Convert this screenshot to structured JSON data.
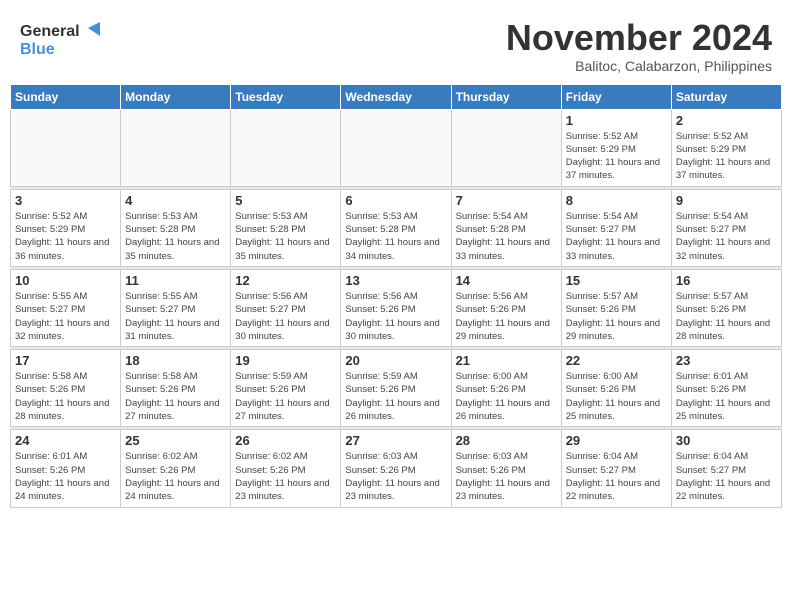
{
  "header": {
    "logo_general": "General",
    "logo_blue": "Blue",
    "month_title": "November 2024",
    "location": "Balitoc, Calabarzon, Philippines"
  },
  "days_of_week": [
    "Sunday",
    "Monday",
    "Tuesday",
    "Wednesday",
    "Thursday",
    "Friday",
    "Saturday"
  ],
  "weeks": [
    [
      {
        "day": "",
        "info": ""
      },
      {
        "day": "",
        "info": ""
      },
      {
        "day": "",
        "info": ""
      },
      {
        "day": "",
        "info": ""
      },
      {
        "day": "",
        "info": ""
      },
      {
        "day": "1",
        "info": "Sunrise: 5:52 AM\nSunset: 5:29 PM\nDaylight: 11 hours and 37 minutes."
      },
      {
        "day": "2",
        "info": "Sunrise: 5:52 AM\nSunset: 5:29 PM\nDaylight: 11 hours and 37 minutes."
      }
    ],
    [
      {
        "day": "3",
        "info": "Sunrise: 5:52 AM\nSunset: 5:29 PM\nDaylight: 11 hours and 36 minutes."
      },
      {
        "day": "4",
        "info": "Sunrise: 5:53 AM\nSunset: 5:28 PM\nDaylight: 11 hours and 35 minutes."
      },
      {
        "day": "5",
        "info": "Sunrise: 5:53 AM\nSunset: 5:28 PM\nDaylight: 11 hours and 35 minutes."
      },
      {
        "day": "6",
        "info": "Sunrise: 5:53 AM\nSunset: 5:28 PM\nDaylight: 11 hours and 34 minutes."
      },
      {
        "day": "7",
        "info": "Sunrise: 5:54 AM\nSunset: 5:28 PM\nDaylight: 11 hours and 33 minutes."
      },
      {
        "day": "8",
        "info": "Sunrise: 5:54 AM\nSunset: 5:27 PM\nDaylight: 11 hours and 33 minutes."
      },
      {
        "day": "9",
        "info": "Sunrise: 5:54 AM\nSunset: 5:27 PM\nDaylight: 11 hours and 32 minutes."
      }
    ],
    [
      {
        "day": "10",
        "info": "Sunrise: 5:55 AM\nSunset: 5:27 PM\nDaylight: 11 hours and 32 minutes."
      },
      {
        "day": "11",
        "info": "Sunrise: 5:55 AM\nSunset: 5:27 PM\nDaylight: 11 hours and 31 minutes."
      },
      {
        "day": "12",
        "info": "Sunrise: 5:56 AM\nSunset: 5:27 PM\nDaylight: 11 hours and 30 minutes."
      },
      {
        "day": "13",
        "info": "Sunrise: 5:56 AM\nSunset: 5:26 PM\nDaylight: 11 hours and 30 minutes."
      },
      {
        "day": "14",
        "info": "Sunrise: 5:56 AM\nSunset: 5:26 PM\nDaylight: 11 hours and 29 minutes."
      },
      {
        "day": "15",
        "info": "Sunrise: 5:57 AM\nSunset: 5:26 PM\nDaylight: 11 hours and 29 minutes."
      },
      {
        "day": "16",
        "info": "Sunrise: 5:57 AM\nSunset: 5:26 PM\nDaylight: 11 hours and 28 minutes."
      }
    ],
    [
      {
        "day": "17",
        "info": "Sunrise: 5:58 AM\nSunset: 5:26 PM\nDaylight: 11 hours and 28 minutes."
      },
      {
        "day": "18",
        "info": "Sunrise: 5:58 AM\nSunset: 5:26 PM\nDaylight: 11 hours and 27 minutes."
      },
      {
        "day": "19",
        "info": "Sunrise: 5:59 AM\nSunset: 5:26 PM\nDaylight: 11 hours and 27 minutes."
      },
      {
        "day": "20",
        "info": "Sunrise: 5:59 AM\nSunset: 5:26 PM\nDaylight: 11 hours and 26 minutes."
      },
      {
        "day": "21",
        "info": "Sunrise: 6:00 AM\nSunset: 5:26 PM\nDaylight: 11 hours and 26 minutes."
      },
      {
        "day": "22",
        "info": "Sunrise: 6:00 AM\nSunset: 5:26 PM\nDaylight: 11 hours and 25 minutes."
      },
      {
        "day": "23",
        "info": "Sunrise: 6:01 AM\nSunset: 5:26 PM\nDaylight: 11 hours and 25 minutes."
      }
    ],
    [
      {
        "day": "24",
        "info": "Sunrise: 6:01 AM\nSunset: 5:26 PM\nDaylight: 11 hours and 24 minutes."
      },
      {
        "day": "25",
        "info": "Sunrise: 6:02 AM\nSunset: 5:26 PM\nDaylight: 11 hours and 24 minutes."
      },
      {
        "day": "26",
        "info": "Sunrise: 6:02 AM\nSunset: 5:26 PM\nDaylight: 11 hours and 23 minutes."
      },
      {
        "day": "27",
        "info": "Sunrise: 6:03 AM\nSunset: 5:26 PM\nDaylight: 11 hours and 23 minutes."
      },
      {
        "day": "28",
        "info": "Sunrise: 6:03 AM\nSunset: 5:26 PM\nDaylight: 11 hours and 23 minutes."
      },
      {
        "day": "29",
        "info": "Sunrise: 6:04 AM\nSunset: 5:27 PM\nDaylight: 11 hours and 22 minutes."
      },
      {
        "day": "30",
        "info": "Sunrise: 6:04 AM\nSunset: 5:27 PM\nDaylight: 11 hours and 22 minutes."
      }
    ]
  ]
}
